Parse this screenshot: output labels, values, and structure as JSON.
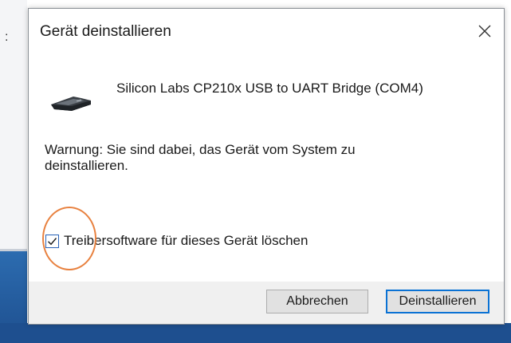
{
  "background": {
    "left_glyph": ":"
  },
  "dialog": {
    "title": "Gerät deinstallieren",
    "close_icon": "close-icon",
    "device": {
      "icon": "usb-device-icon",
      "name": "Silicon Labs CP210x USB to UART Bridge (COM4)"
    },
    "warning": "Warnung: Sie sind dabei, das Gerät vom System zu deinstallieren.",
    "checkbox": {
      "label": "Treibersoftware für dieses Gerät löschen",
      "checked": true
    },
    "buttons": {
      "cancel": "Abbrechen",
      "uninstall": "Deinstallieren"
    }
  },
  "colors": {
    "highlight_circle": "#e8813f",
    "default_button_border": "#0a72d4",
    "checkbox_accent": "#2a63b8"
  }
}
